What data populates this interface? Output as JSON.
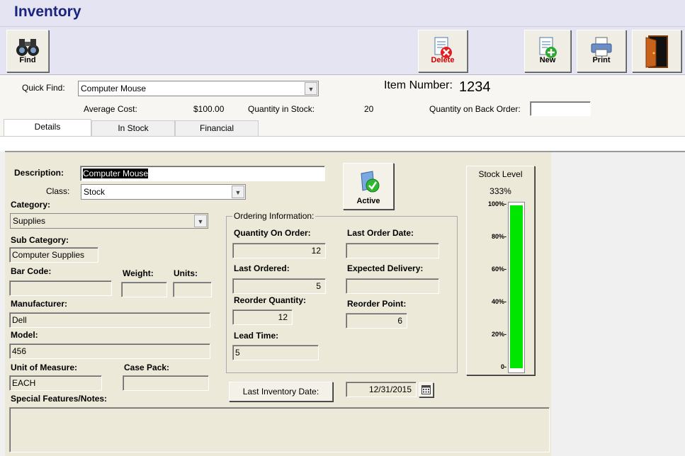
{
  "window": {
    "title": "Inventory"
  },
  "toolbar": {
    "find_label": "Find",
    "delete_label": "Delete",
    "new_label": "New",
    "print_label": "Print"
  },
  "header": {
    "quick_find_label": "Quick Find:",
    "quick_find_value": "Computer Mouse",
    "item_number_label": "Item Number:",
    "item_number_value": "1234",
    "average_cost_label": "Average Cost:",
    "average_cost_value": "$100.00",
    "qty_in_stock_label": "Quantity in Stock:",
    "qty_in_stock_value": "20",
    "qty_back_order_label": "Quantity on Back Order:",
    "qty_back_order_value": ""
  },
  "tabs": [
    {
      "label": "Details",
      "active": true
    },
    {
      "label": "In Stock",
      "active": false
    },
    {
      "label": "Financial",
      "active": false
    }
  ],
  "details": {
    "description_label": "Description:",
    "description_value": "Computer Mouse",
    "class_label": "Class:",
    "class_value": "Stock",
    "category_label": "Category:",
    "category_value": "Supplies",
    "sub_category_label": "Sub Category:",
    "sub_category_value": "Computer Supplies",
    "bar_code_label": "Bar Code:",
    "bar_code_value": "",
    "weight_label": "Weight:",
    "weight_value": "",
    "units_label": "Units:",
    "units_value": "",
    "manufacturer_label": "Manufacturer:",
    "manufacturer_value": "Dell",
    "model_label": "Model:",
    "model_value": "456",
    "uom_label": "Unit of Measure:",
    "uom_value": "EACH",
    "case_pack_label": "Case Pack:",
    "case_pack_value": "",
    "notes_label": "Special Features/Notes:",
    "notes_value": "",
    "active_label": "Active"
  },
  "ordering": {
    "caption": "Ordering Information:",
    "qty_on_order_label": "Quantity On Order:",
    "qty_on_order_value": "12",
    "last_order_date_label": "Last Order Date:",
    "last_order_date_value": "",
    "last_ordered_label": "Last Ordered:",
    "last_ordered_value": "5",
    "expected_delivery_label": "Expected Delivery:",
    "expected_delivery_value": "",
    "reorder_qty_label": "Reorder Quantity:",
    "reorder_qty_value": "12",
    "reorder_point_label": "Reorder Point:",
    "reorder_point_value": "6",
    "lead_time_label": "Lead Time:",
    "lead_time_value": "5"
  },
  "inventory_date": {
    "button_label": "Last Inventory Date:",
    "value": "12/31/2015"
  },
  "stock_level": {
    "title": "Stock Level",
    "percent_label": "333%",
    "fill_fraction": 1.0,
    "ticks": [
      "100%-",
      "80%-",
      "60%-",
      "40%-",
      "20%-",
      "0-"
    ],
    "bar_color": "#00e600"
  }
}
